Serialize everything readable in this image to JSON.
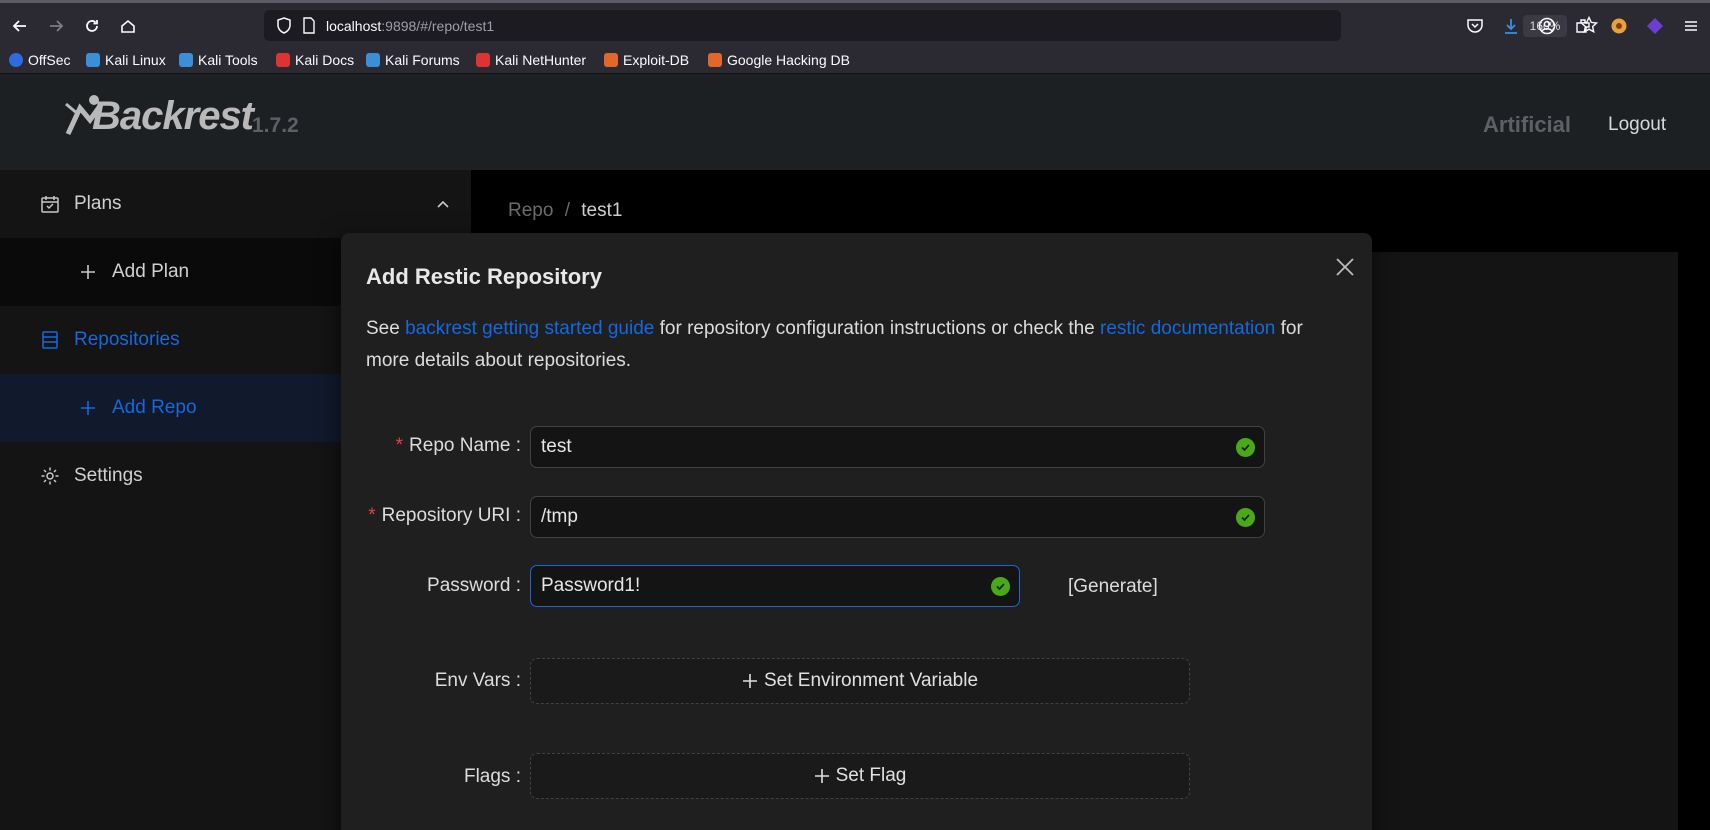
{
  "browser": {
    "url_host": "localhost",
    "url_rest": ":9898/#/repo/test1",
    "zoom": "160%",
    "bookmarks": [
      {
        "label": "OffSec",
        "color": "#2d6cdf"
      },
      {
        "label": "Kali Linux",
        "color": "#3a8fd6"
      },
      {
        "label": "Kali Tools",
        "color": "#3a8fd6"
      },
      {
        "label": "Kali Docs",
        "color": "#d33"
      },
      {
        "label": "Kali Forums",
        "color": "#3a8fd6"
      },
      {
        "label": "Kali NetHunter",
        "color": "#d33"
      },
      {
        "label": "Exploit-DB",
        "color": "#e2672b"
      },
      {
        "label": "Google Hacking DB",
        "color": "#e2672b"
      }
    ]
  },
  "header": {
    "logo": "Backrest",
    "version": "1.7.2",
    "user": "Artificial",
    "logout": "Logout"
  },
  "sidebar": {
    "plans": "Plans",
    "add_plan": "Add Plan",
    "repositories": "Repositories",
    "add_repo": "Add Repo",
    "settings": "Settings"
  },
  "breadcrumb": {
    "parent": "Repo",
    "separator": "/",
    "current": "test1"
  },
  "modal": {
    "title": "Add Restic Repository",
    "desc_prefix": "See ",
    "link1": "backrest getting started guide",
    "desc_mid": " for repository configuration instructions or check the ",
    "link2": "restic documentation",
    "desc_suffix": " for more details about repositories.",
    "fields": {
      "repo_name_label": "Repo Name",
      "repo_name_value": "test",
      "uri_label": "Repository URI",
      "uri_value": "/tmp",
      "password_label": "Password",
      "password_value": "Password1!",
      "generate": "[Generate]",
      "env_label": "Env Vars",
      "env_button": "Set Environment Variable",
      "flags_label": "Flags",
      "flags_button": "Set Flag"
    }
  },
  "colors": {
    "accent": "#1668dc",
    "success": "#49aa19",
    "required": "#dc4446"
  }
}
